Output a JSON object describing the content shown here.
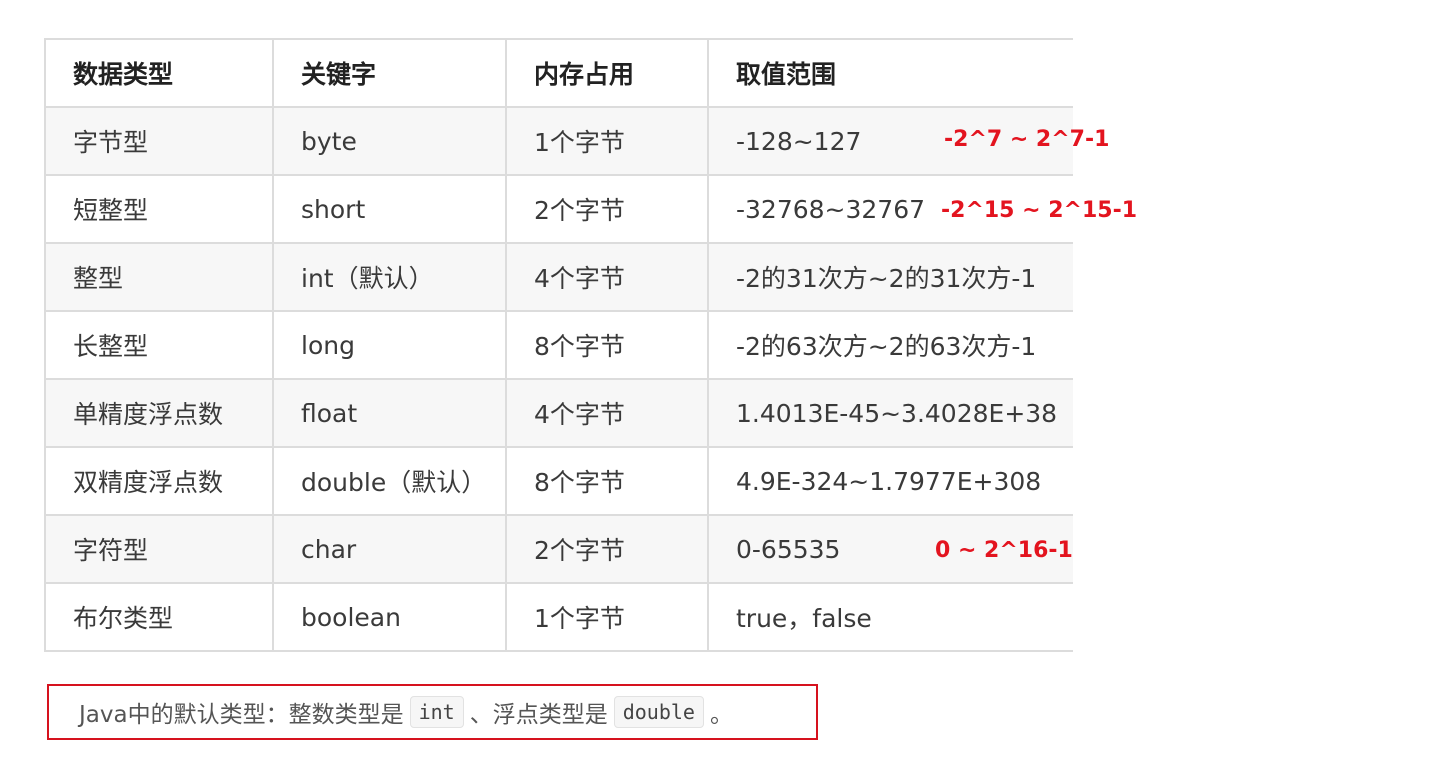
{
  "table": {
    "headers": [
      "数据类型",
      "关键字",
      "内存占用",
      "取值范围"
    ],
    "rows": [
      [
        "字节型",
        "byte",
        "1个字节",
        "-128~127"
      ],
      [
        "短整型",
        "short",
        "2个字节",
        "-32768~32767"
      ],
      [
        "整型",
        "int（默认）",
        "4个字节",
        "-2的31次方~2的31次方-1"
      ],
      [
        "长整型",
        "long",
        "8个字节",
        "-2的63次方~2的63次方-1"
      ],
      [
        "单精度浮点数",
        "float",
        "4个字节",
        "1.4013E-45~3.4028E+38"
      ],
      [
        "双精度浮点数",
        "double（默认）",
        "8个字节",
        "4.9E-324~1.7977E+308"
      ],
      [
        "字符型",
        "char",
        "2个字节",
        "0-65535"
      ],
      [
        "布尔类型",
        "boolean",
        "1个字节",
        "true，false"
      ]
    ]
  },
  "annotations": {
    "byte": "-2^7 ~ 2^7-1",
    "short": "-2^15 ~ 2^15-1",
    "char": "0 ~ 2^16-1"
  },
  "note": {
    "prefix": "Java中的默认类型：整数类型是",
    "int_code": "int",
    "middle": "、浮点类型是",
    "double_code": "double",
    "suffix": "。"
  },
  "colors": {
    "annotation": "#e3141f",
    "note_border": "#d6121e",
    "table_border": "#dcdcdc",
    "row_stripe": "#f7f7f7"
  }
}
